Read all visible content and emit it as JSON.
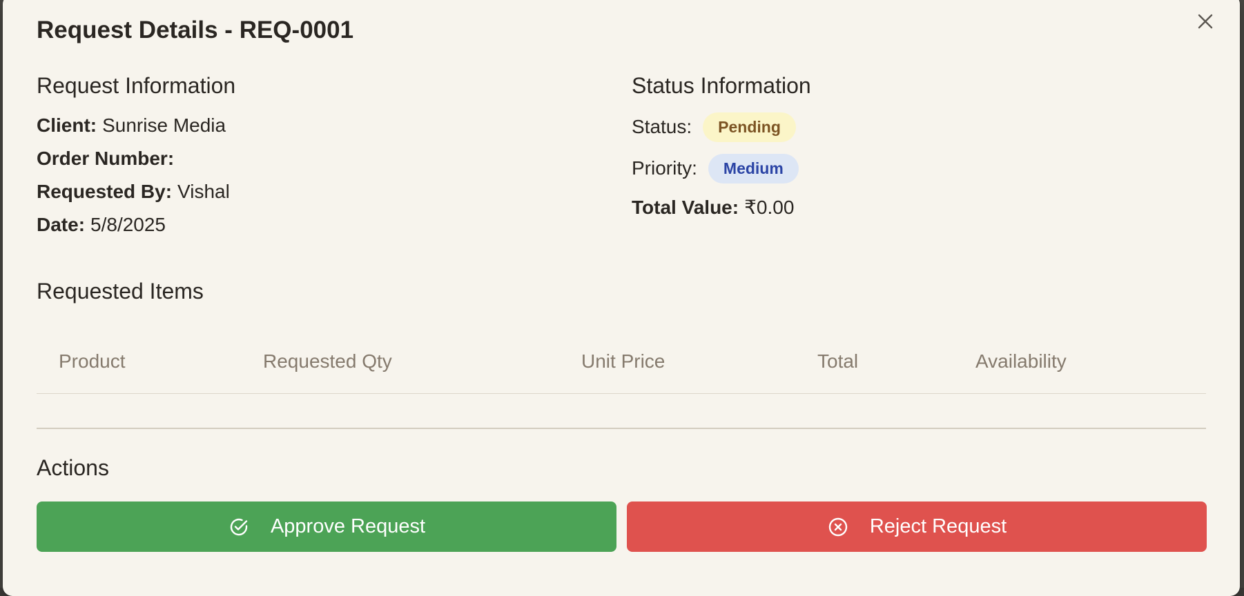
{
  "modal": {
    "title": "Request Details - REQ-0001",
    "close_icon": "close-icon"
  },
  "request_info": {
    "heading": "Request Information",
    "client_label": "Client:",
    "client_value": "Sunrise Media",
    "order_label": "Order Number:",
    "order_value": "",
    "requested_by_label": "Requested By:",
    "requested_by_value": "Vishal",
    "date_label": "Date:",
    "date_value": "5/8/2025"
  },
  "status_info": {
    "heading": "Status Information",
    "status_label": "Status:",
    "status_value": "Pending",
    "priority_label": "Priority:",
    "priority_value": "Medium",
    "total_label": "Total Value:",
    "total_value": "₹0.00"
  },
  "items": {
    "heading": "Requested Items",
    "columns": [
      "Product",
      "Requested Qty",
      "Unit Price",
      "Total",
      "Availability"
    ],
    "rows": []
  },
  "actions": {
    "heading": "Actions",
    "approve_label": "Approve Request",
    "approve_icon": "check-circle-icon",
    "reject_label": "Reject Request",
    "reject_icon": "x-circle-icon"
  },
  "colors": {
    "background": "#f7f4ed",
    "approve": "#4ca356",
    "reject": "#df524e",
    "pending_bg": "#fbf5c8",
    "pending_text": "#7c5424",
    "medium_bg": "#dde6f5",
    "medium_text": "#2b44a5"
  }
}
